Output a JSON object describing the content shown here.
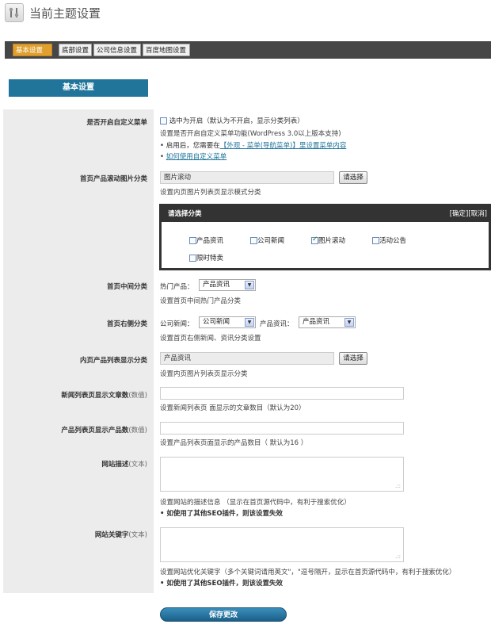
{
  "header": {
    "title": "当前主题设置",
    "icon": "tools-icon"
  },
  "tabs": [
    {
      "label": "基本设置",
      "active": true
    },
    {
      "label": "底部设置",
      "active": false
    },
    {
      "label": "公司信息设置",
      "active": false
    },
    {
      "label": "百度地图设置",
      "active": false
    }
  ],
  "section_title": "基本设置",
  "custom_menu": {
    "label": "是否开启自定义菜单",
    "checkbox_text": "选中为开启（默认为不开启，显示分类列表）",
    "desc": "设置是否开启自定义菜单功能(WordPress 3.0以上版本支持)",
    "note_prefix": "• 启用后，您需要在",
    "note_link": "【外观 - 菜单(导航菜单)】里设置菜单内容",
    "help_prefix": "• ",
    "help_link": "如何使用自定义菜单"
  },
  "slide_category": {
    "label": "首页产品滚动图片分类",
    "value": "图片滚动",
    "button": "请选择",
    "desc": "设置内页图片列表页显示模式分类"
  },
  "category_picker": {
    "title": "请选择分类",
    "actions": "[确定][取消]",
    "options": [
      {
        "label": "产品资讯",
        "checked": false
      },
      {
        "label": "公司新闻",
        "checked": false
      },
      {
        "label": "图片滚动",
        "checked": true
      },
      {
        "label": "活动公告",
        "checked": false
      },
      {
        "label": "限时特卖",
        "checked": false
      }
    ]
  },
  "home_middle": {
    "label": "首页中间分类",
    "prefix": "热门产品：",
    "selected": "产品资讯",
    "desc": "设置首页中间热门产品分类"
  },
  "home_right": {
    "label": "首页右侧分类",
    "prefix1": "公司新闻：",
    "selected1": "公司新闻",
    "prefix2": "产品资讯：",
    "selected2": "产品资讯",
    "desc": "设置首页右侧新闻、资讯分类设置"
  },
  "product_list": {
    "label": "内页产品列表显示分类",
    "value": "产品资讯",
    "button": "请选择",
    "desc": "设置内页图片列表页显示分类"
  },
  "news_count": {
    "label": "新闻列表页显示文章数",
    "sub": "(数值)",
    "value": "",
    "desc": "设置新闻列表页 面显示的文章数目（默认为20）"
  },
  "product_count": {
    "label": "产品列表页显示产品数",
    "sub": "(数值)",
    "value": "",
    "desc": "设置产品列表页面显示的产品数目（ 默认为16 ）"
  },
  "site_desc": {
    "label": "网站描述",
    "sub": "(文本)",
    "desc": "设置网站的描述信息 （显示在首页源代码中，有利于搜索优化）",
    "note": "• 如使用了其他SEO插件，则该设置失效"
  },
  "site_keywords": {
    "label": "网站关键字",
    "sub": "(文本)",
    "desc": "设置网站优化关键字（多个关键词请用英文\"，\"逗号隔开，显示在首页源代码中，有利于搜索优化）",
    "note": "• 如使用了其他SEO插件，则该设置失效"
  },
  "save_button": "保存更改",
  "colors": {
    "accent": "#21759b",
    "tab_active": "#e0a030",
    "tabbar": "#464646"
  }
}
